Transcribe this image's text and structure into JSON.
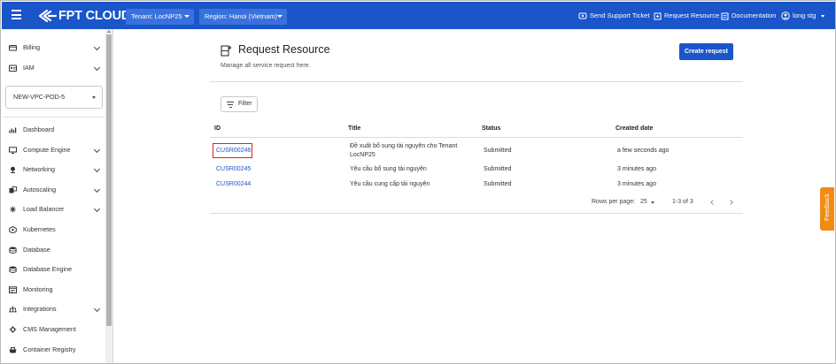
{
  "topbar": {
    "logo_text": "FPT CLOUD",
    "tenant": "Tenant: LocNP25",
    "region": "Region: Hanoi (Vietnam)",
    "links": {
      "support": "Send Support Ticket",
      "request": "Request Resource",
      "docs": "Documentation",
      "user": "long stg"
    },
    "colors": {
      "bar": "#1a55c9",
      "pill": "#3a72dd"
    }
  },
  "sidebar": {
    "items_top": [
      {
        "label": "Billing",
        "icon": "billing-icon",
        "expandable": true
      },
      {
        "label": "IAM",
        "icon": "iam-icon",
        "expandable": true
      }
    ],
    "vpc_select": "NEW-VPC-POD-5",
    "items": [
      {
        "label": "Dashboard",
        "icon": "chart-icon",
        "expandable": false
      },
      {
        "label": "Compute Engine",
        "icon": "monitor-icon",
        "expandable": true
      },
      {
        "label": "Networking",
        "icon": "network-icon",
        "expandable": true
      },
      {
        "label": "Autoscaling",
        "icon": "autoscaling-icon",
        "expandable": true
      },
      {
        "label": "Load Balancer",
        "icon": "load-balancer-icon",
        "expandable": true
      },
      {
        "label": "Kubernetes",
        "icon": "kubernetes-icon",
        "expandable": false
      },
      {
        "label": "Database",
        "icon": "database-icon",
        "expandable": false
      },
      {
        "label": "Database Engine",
        "icon": "database-engine-icon",
        "expandable": false
      },
      {
        "label": "Monitoring",
        "icon": "monitoring-icon",
        "expandable": false
      },
      {
        "label": "Integrations",
        "icon": "integrations-icon",
        "expandable": true
      },
      {
        "label": "CMS Management",
        "icon": "cms-icon",
        "expandable": false
      },
      {
        "label": "Container Registry",
        "icon": "container-icon",
        "expandable": false
      }
    ]
  },
  "main": {
    "title": "Request Resource",
    "subtitle": "Manage all service request here.",
    "create_button": "Create request",
    "filter_button": "Filter",
    "columns": [
      "ID",
      "Title",
      "Status",
      "Created date"
    ],
    "rows": [
      {
        "id": "CUSR00246",
        "title_line1": "Đề xuất bổ sung tài nguyên cho Tenant",
        "title_line2": "LocNP25",
        "status": "Submitted",
        "created": "a few seconds ago"
      },
      {
        "id": "CUSR00245",
        "title_line1": "Yêu cầu bổ sung tài nguyên",
        "title_line2": "",
        "status": "Submitted",
        "created": "3 minutes ago"
      },
      {
        "id": "CUSR00244",
        "title_line1": "Yêu cầu cung cấp tài nguyên",
        "title_line2": "",
        "status": "Submitted",
        "created": "3 minutes ago"
      }
    ],
    "pagination": {
      "rows_per_page_label": "Rows per page:",
      "rows_per_page": "25",
      "range": "1-3 of 3"
    }
  },
  "feedback_tab": "Feedback",
  "highlight_color": "#e02020"
}
